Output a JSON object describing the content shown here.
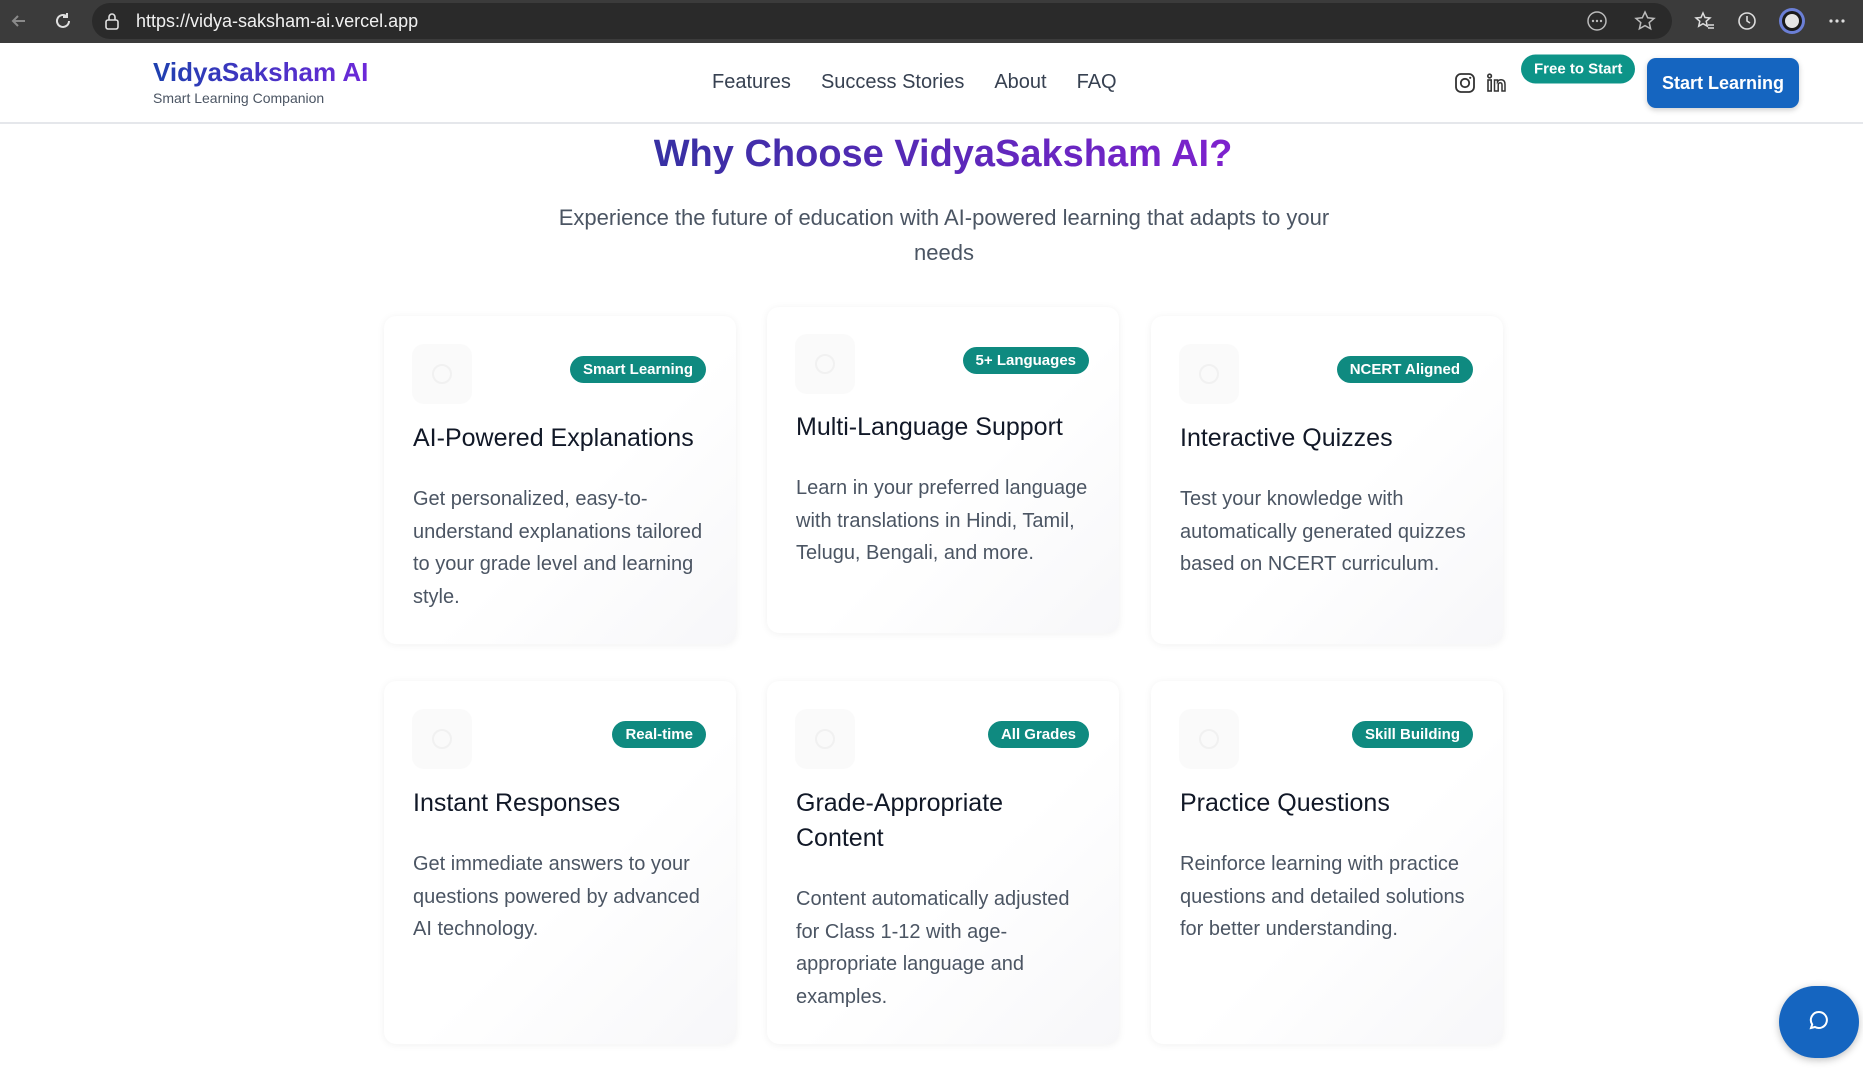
{
  "browser": {
    "url": "https://vidya-saksham-ai.vercel.app"
  },
  "header": {
    "brand_name": "VidyaSaksham AI",
    "brand_tagline": "Smart Learning Companion",
    "nav": [
      "Features",
      "Success Stories",
      "About",
      "FAQ"
    ],
    "free_badge": "Free to Start",
    "cta": "Start Learning"
  },
  "section": {
    "title": "Why Choose VidyaSaksham AI?",
    "subtitle": "Experience the future of education with AI-powered learning that adapts to your needs"
  },
  "cards": [
    {
      "badge": "Smart Learning",
      "title": "AI-Powered Explanations",
      "description": "Get personalized, easy-to-understand explanations tailored to your grade level and learning style."
    },
    {
      "badge": "5+ Languages",
      "title": "Multi-Language Support",
      "description": "Learn in your preferred language with translations in Hindi, Tamil, Telugu, Bengali, and more."
    },
    {
      "badge": "NCERT Aligned",
      "title": "Interactive Quizzes",
      "description": "Test your knowledge with automatically generated quizzes based on NCERT curriculum."
    },
    {
      "badge": "Real-time",
      "title": "Instant Responses",
      "description": "Get immediate answers to your questions powered by advanced AI technology."
    },
    {
      "badge": "All Grades",
      "title": "Grade-Appropriate Content",
      "description": "Content automatically adjusted for Class 1-12 with age-appropriate language and examples."
    },
    {
      "badge": "Skill Building",
      "title": "Practice Questions",
      "description": "Reinforce learning with practice questions and detailed solutions for better understanding."
    }
  ],
  "colors": {
    "primary": "#1565c0",
    "badge": "#0f8a80",
    "title_gradient_start": "#3730a3",
    "title_gradient_end": "#7e22ce"
  }
}
